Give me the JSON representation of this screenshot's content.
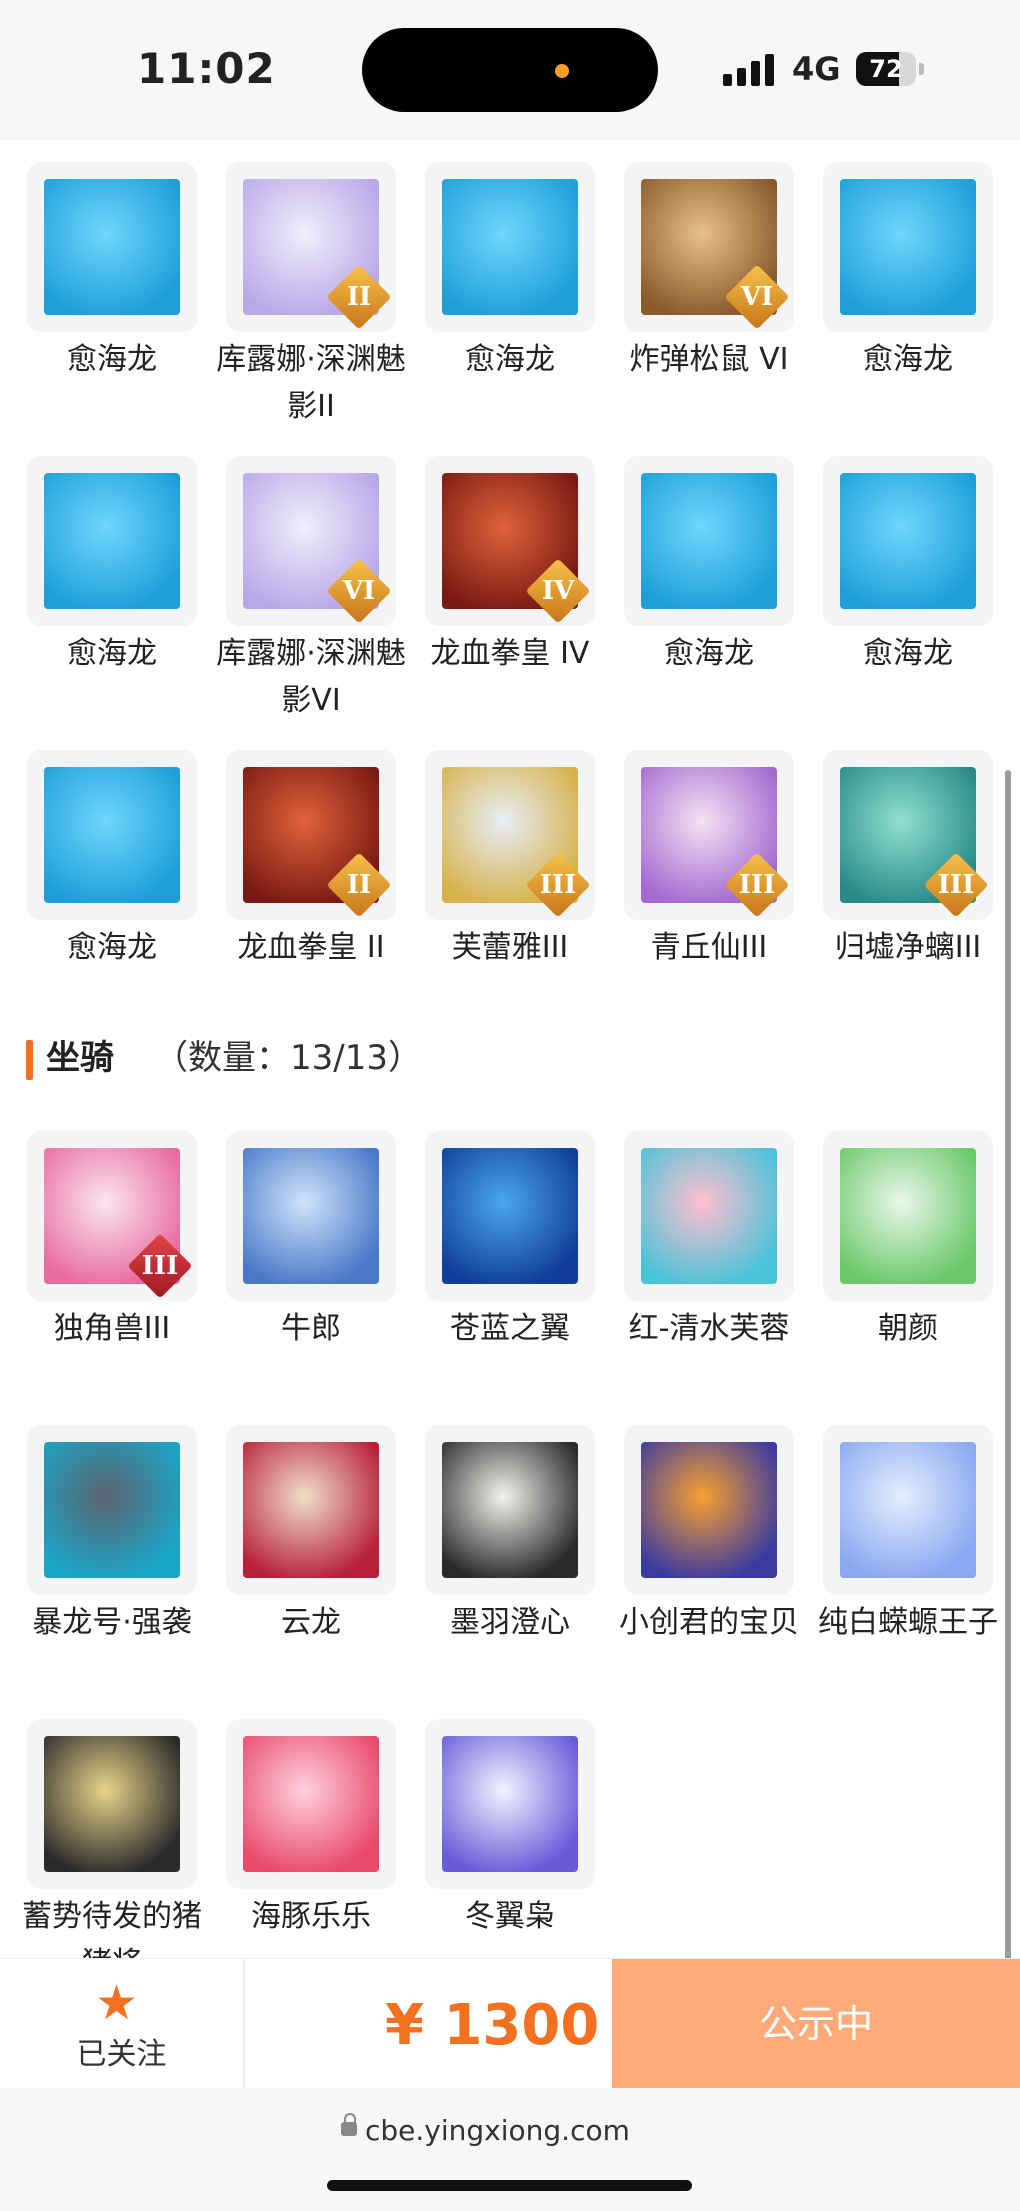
{
  "status_bar": {
    "time": "11:02",
    "network": "4G",
    "battery": "72",
    "battery_level": 0.72
  },
  "pets": [
    {
      "name": "愈海龙",
      "icon": "sea-dragon-icon",
      "rank": "",
      "colors": [
        "#6fd6ff",
        "#1e9fd8"
      ]
    },
    {
      "name": "库露娜·深渊魅影II",
      "icon": "doll-girl-icon",
      "rank": "II",
      "colors": [
        "#f1eefb",
        "#b8a8e8"
      ]
    },
    {
      "name": "愈海龙",
      "icon": "sea-dragon-icon",
      "rank": "",
      "colors": [
        "#6fd6ff",
        "#1e9fd8"
      ]
    },
    {
      "name": "炸弹松鼠 VI",
      "icon": "squirrel-icon",
      "rank": "VI",
      "colors": [
        "#e8c08a",
        "#8a5a2a"
      ]
    },
    {
      "name": "愈海龙",
      "icon": "sea-dragon-icon",
      "rank": "",
      "colors": [
        "#6fd6ff",
        "#1e9fd8"
      ]
    },
    {
      "name": "愈海龙",
      "icon": "sea-dragon-icon",
      "rank": "",
      "colors": [
        "#6fd6ff",
        "#1e9fd8"
      ]
    },
    {
      "name": "库露娜·深渊魅影VI",
      "icon": "doll-girl-icon",
      "rank": "VI",
      "colors": [
        "#f1eefb",
        "#b8a8e8"
      ]
    },
    {
      "name": "龙血拳皇 IV",
      "icon": "ram-beast-icon",
      "rank": "IV",
      "colors": [
        "#e0623a",
        "#7a1a14"
      ]
    },
    {
      "name": "愈海龙",
      "icon": "sea-dragon-icon",
      "rank": "",
      "colors": [
        "#6fd6ff",
        "#1e9fd8"
      ]
    },
    {
      "name": "愈海龙",
      "icon": "sea-dragon-icon",
      "rank": "",
      "colors": [
        "#6fd6ff",
        "#1e9fd8"
      ]
    },
    {
      "name": "愈海龙",
      "icon": "sea-dragon-icon",
      "rank": "",
      "colors": [
        "#6fd6ff",
        "#1e9fd8"
      ]
    },
    {
      "name": "龙血拳皇 II",
      "icon": "ram-beast-icon",
      "rank": "II",
      "colors": [
        "#e0623a",
        "#7a1a14"
      ]
    },
    {
      "name": "芙蕾雅III",
      "icon": "valkyrie-icon",
      "rank": "III",
      "colors": [
        "#e8eef8",
        "#d6b24a"
      ]
    },
    {
      "name": "青丘仙III",
      "icon": "fox-fairy-icon",
      "rank": "III",
      "colors": [
        "#f4e2f4",
        "#a46ad0"
      ]
    },
    {
      "name": "归墟净螭III",
      "icon": "jade-dragon-icon",
      "rank": "III",
      "colors": [
        "#8fe0d0",
        "#2a8a88"
      ]
    }
  ],
  "mounts_section": {
    "title": "坐骑",
    "count": "（数量：13/13）"
  },
  "mounts": [
    {
      "name": "独角兽III",
      "icon": "unicorn-icon",
      "rank": "III",
      "colors": [
        "#fbe6f0",
        "#e86aa0"
      ]
    },
    {
      "name": "牛郎",
      "icon": "ox-icon",
      "rank": "",
      "colors": [
        "#cfe4fb",
        "#4a78c8"
      ]
    },
    {
      "name": "苍蓝之翼",
      "icon": "azure-griffin-icon",
      "rank": "",
      "colors": [
        "#4aa6ef",
        "#103e9a"
      ]
    },
    {
      "name": "红-清水芙蓉",
      "icon": "lotus-icon",
      "rank": "",
      "colors": [
        "#ffc0d0",
        "#4ac2d8"
      ]
    },
    {
      "name": "朝颜",
      "icon": "vine-bird-icon",
      "rank": "",
      "colors": [
        "#eaf7ea",
        "#6ac86a"
      ]
    },
    {
      "name": "暴龙号·强袭",
      "icon": "mech-dragon-icon",
      "rank": "",
      "colors": [
        "#5a6470",
        "#1aa6c8"
      ]
    },
    {
      "name": "云龙",
      "icon": "cloud-dragon-icon",
      "rank": "",
      "colors": [
        "#f0e0c8",
        "#b8203a"
      ]
    },
    {
      "name": "墨羽澄心",
      "icon": "feather-staff-icon",
      "rank": "",
      "colors": [
        "#f4f2ee",
        "#2a2a2a"
      ]
    },
    {
      "name": "小创君的宝贝",
      "icon": "phoenix-bird-icon",
      "rank": "",
      "colors": [
        "#f8a030",
        "#3a3aa0"
      ]
    },
    {
      "name": "纯白蝾螈王子",
      "icon": "axolotl-icon",
      "rank": "",
      "colors": [
        "#e4eeff",
        "#8aa8f0"
      ]
    },
    {
      "name": "蓄势待发的猪猪将",
      "icon": "pig-icon",
      "rank": "",
      "colors": [
        "#e8d48a",
        "#2a2a2a"
      ]
    },
    {
      "name": "海豚乐乐",
      "icon": "dolphin-icon",
      "rank": "",
      "colors": [
        "#ffd0e0",
        "#e84a6a"
      ]
    },
    {
      "name": "冬翼枭",
      "icon": "snow-owl-icon",
      "rank": "",
      "colors": [
        "#f0f4ff",
        "#6a5ad8"
      ]
    }
  ],
  "action_bar": {
    "follow_label": "已关注",
    "price": "¥ 1300",
    "status_button": "公示中"
  },
  "url_bar": {
    "url": "cbe.yingxiong.com"
  },
  "colors": {
    "accent": "#f37021",
    "button": "#ffaa78"
  }
}
